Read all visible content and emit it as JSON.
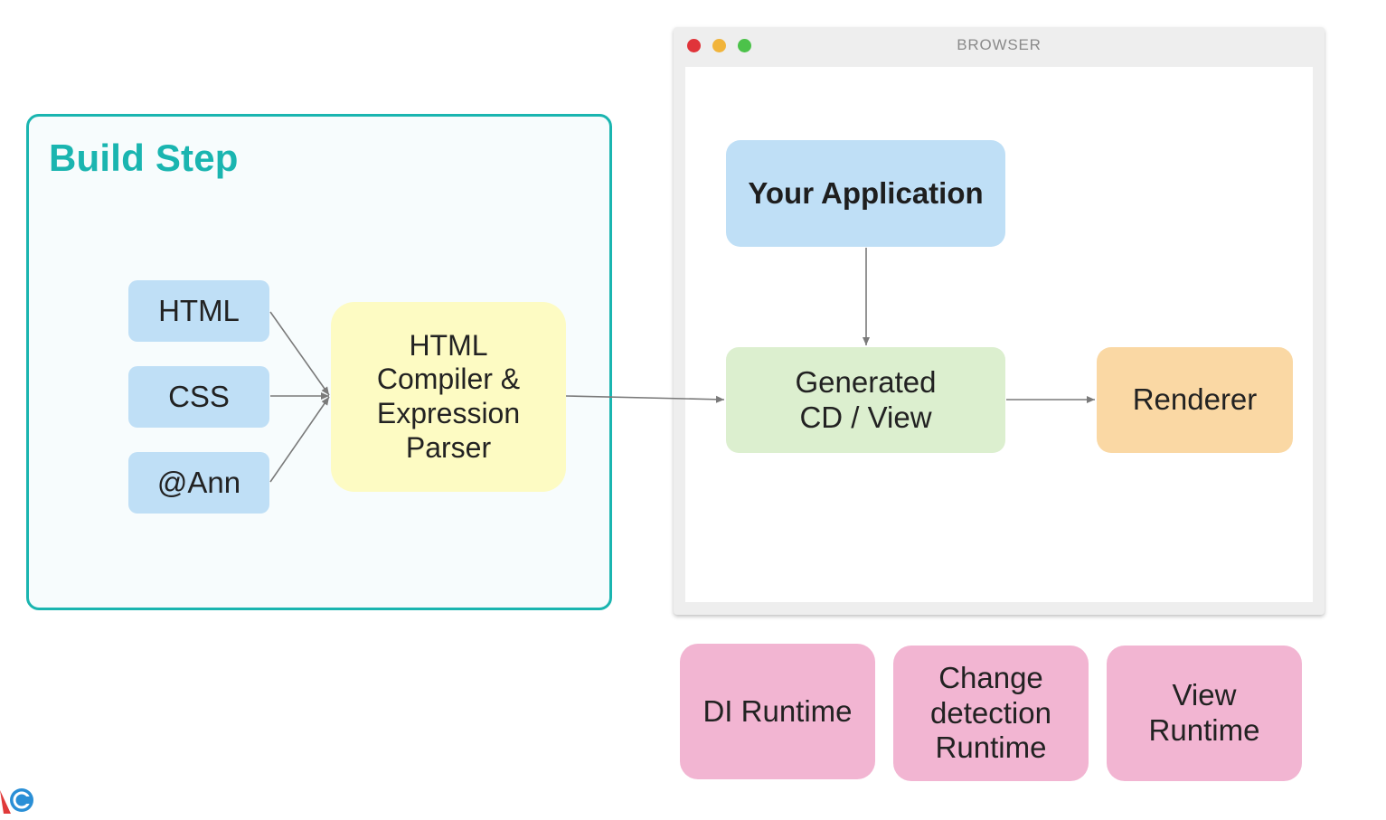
{
  "build_step": {
    "title": "Build Step",
    "color": "#1ab5b0",
    "sources": [
      "HTML",
      "CSS",
      "@Ann"
    ],
    "compiler": "HTML\nCompiler &\nExpression\nParser"
  },
  "browser": {
    "title": "BROWSER",
    "window_dots": [
      "#e0343a",
      "#f1b43b",
      "#4cc24a"
    ],
    "application": "Your Application",
    "generated": "Generated\nCD / View",
    "renderer": "Renderer"
  },
  "runtimes": [
    "DI Runtime",
    "Change\ndetection\nRuntime",
    "View\nRuntime"
  ],
  "colors": {
    "source_box": "#bfdff6",
    "compiler_box": "#fdfbc3",
    "generated_box": "#dcefcf",
    "renderer_box": "#fad8a4",
    "runtime_box": "#f2b5d2",
    "arrow": "#7a7a7a"
  }
}
